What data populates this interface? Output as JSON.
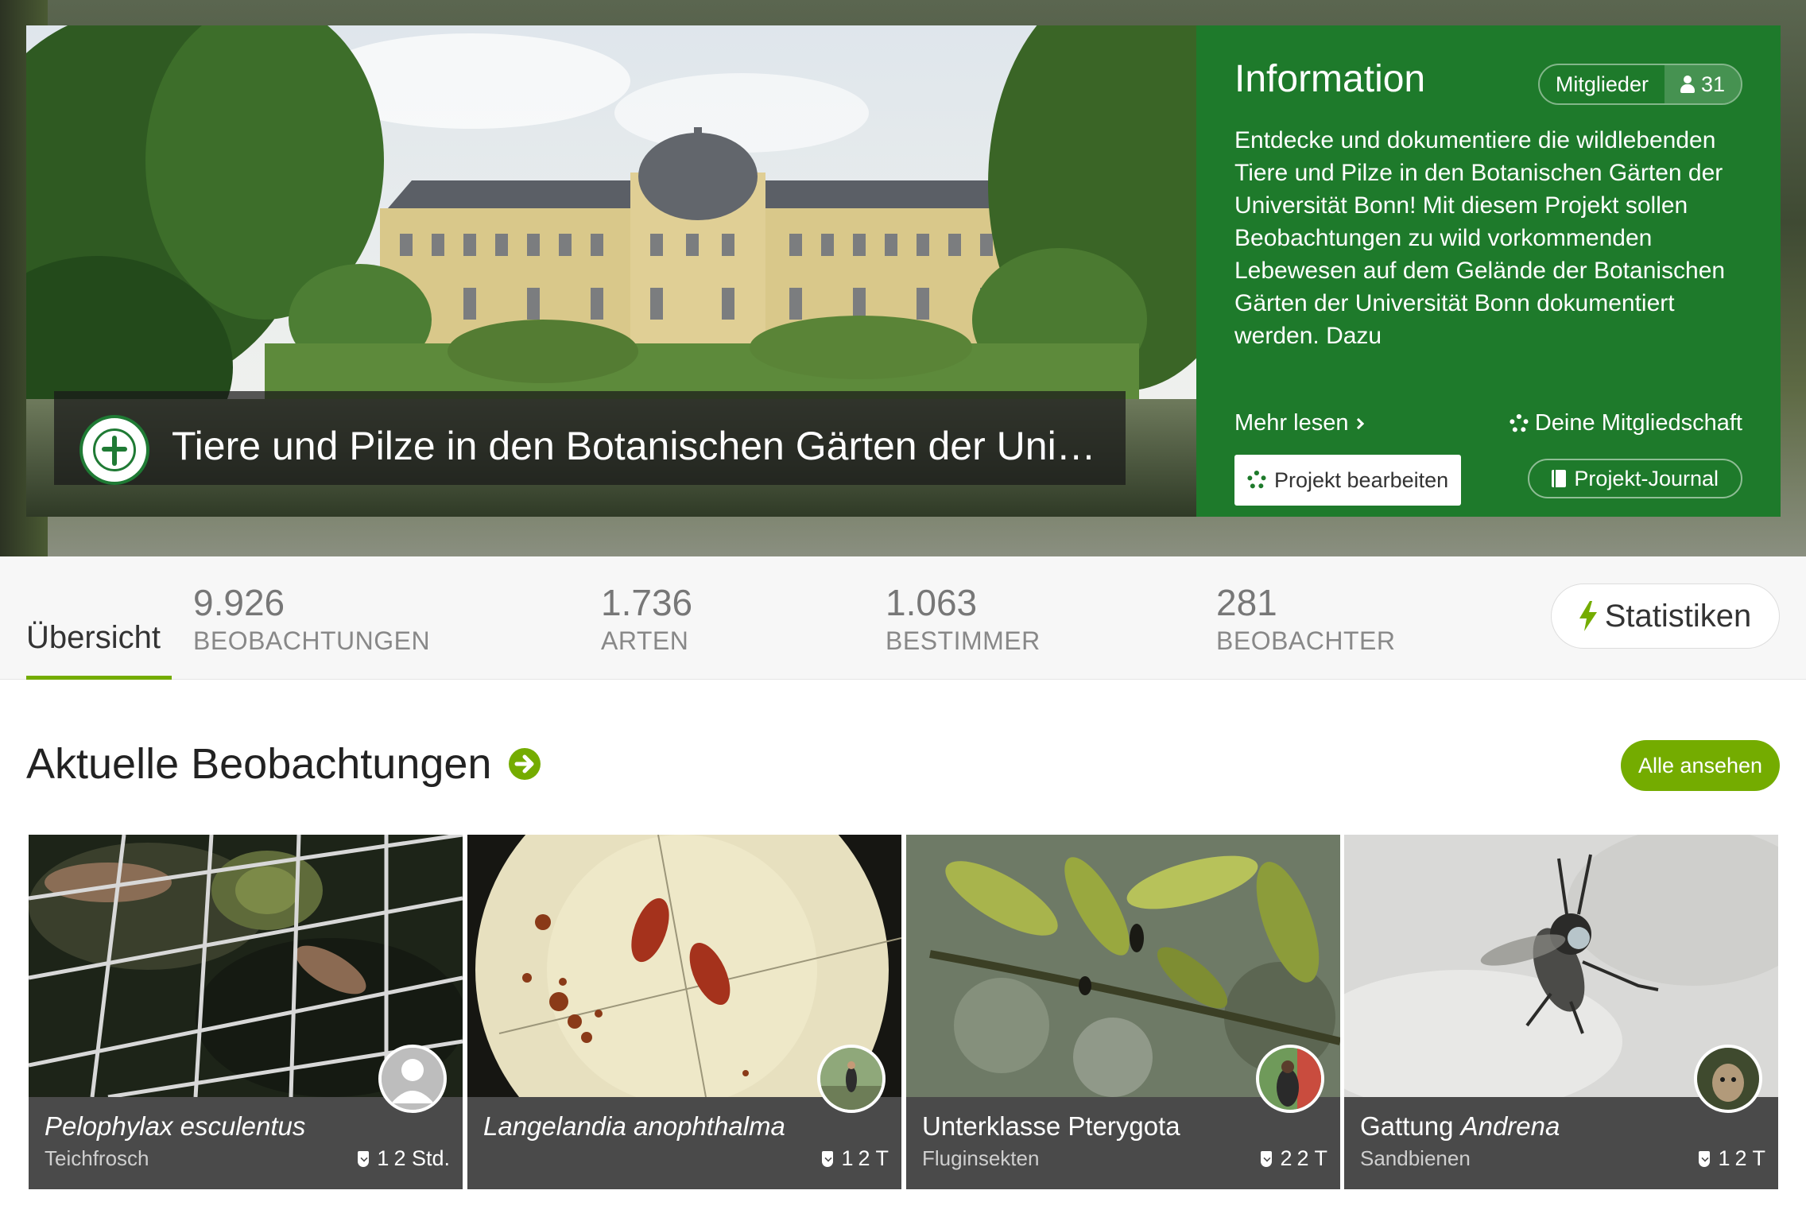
{
  "hero": {
    "project_title": "Tiere und Pilze in den Botanischen Gärten der Univ...",
    "info": {
      "title": "Information",
      "members_label": "Mitglieder",
      "members_count": "31",
      "description": "Entdecke und dokumentiere die wildlebenden Tiere und Pilze in den Botanischen Gärten der Universität Bonn! Mit diesem Projekt sollen Beobachtungen zu wild vorkommenden Lebewesen auf dem Gelände der Botanischen Gärten der Universität Bonn dokumentiert werden. Dazu",
      "more_link": "Mehr lesen",
      "membership_link": "Deine Mitgliedschaft",
      "edit_button": "Projekt bearbeiten",
      "journal_button": "Projekt-Journal"
    }
  },
  "stats": {
    "overview_tab": "Übersicht",
    "observations": {
      "value": "9.926",
      "label": "BEOBACHTUNGEN"
    },
    "species": {
      "value": "1.736",
      "label": "ARTEN"
    },
    "identifiers": {
      "value": "1.063",
      "label": "BESTIMMER"
    },
    "observers": {
      "value": "281",
      "label": "BEOBACHTER"
    },
    "statistics_button": "Statistiken"
  },
  "recent": {
    "title": "Aktuelle Beobachtungen",
    "view_all": "Alle ansehen",
    "cards": [
      {
        "rank": "",
        "name": "Pelophylax esculentus",
        "common": "Teichfrosch",
        "ids": "1",
        "time": "2 Std."
      },
      {
        "rank": "",
        "name": "Langelandia anophthalma",
        "common": "",
        "ids": "1",
        "time": "2 T"
      },
      {
        "rank": "Unterklasse Pterygota",
        "name": "",
        "common": "Fluginsekten",
        "ids": "2",
        "time": "2 T"
      },
      {
        "rank": "Gattung ",
        "name": "Andrena",
        "common": "Sandbienen",
        "ids": "1",
        "time": "2 T"
      }
    ]
  },
  "colors": {
    "brand_green": "#74ac00",
    "info_green": "#1e7a2b"
  }
}
